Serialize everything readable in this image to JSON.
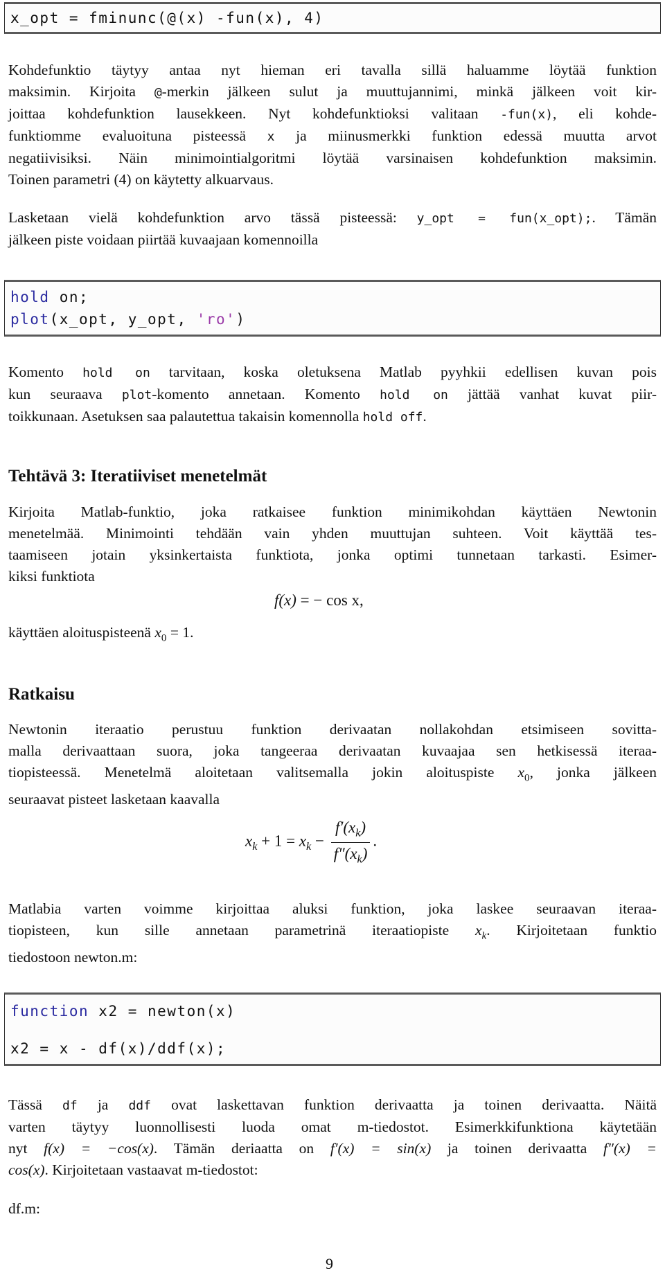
{
  "code_block_1": {
    "lines": [
      "x_opt = fminunc(@(x) -fun(x), 4)"
    ]
  },
  "paragraph_1": {
    "lines": [
      "Kohdefunktio täytyy antaa nyt hieman eri tavalla sillä haluamme löytää funktion",
      "maksimin. Kirjoita @-merkin jälkeen sulut ja muuttujannimi, minkä jälkeen voit kir-",
      "joittaa kohdefunktion lausekkeen. Nyt kohdefunktioksi valitaan -fun(x), eli kohde-",
      "funktiomme evaluoituna pisteessä x ja miinusmerkki funktion edessä muutta arvot",
      "negatiivisiksi. Näin minimointialgoritmi löytää varsinaisen kohdefunktion maksimin.",
      "Toinen parametri (4) on käytetty alkuarvaus."
    ],
    "segments": {
      "l2_a": "maksimin. Kirjoita ",
      "l2_code": "@",
      "l2_b": "-merkin jälkeen sulut ja muuttujannimi, minkä jälkeen voit kir-",
      "l3_a": "joittaa kohdefunktion lausekkeen. Nyt kohdefunktioksi valitaan ",
      "l3_code": "-fun(x)",
      "l3_b": ", eli kohde-",
      "l4_a": "funktiomme evaluoituna pisteessä ",
      "l4_code": "x",
      "l4_b": " ja miinusmerkki funktion edessä muutta arvot"
    }
  },
  "paragraph_2": {
    "l1_a": "Lasketaan vielä kohdefunktion arvo tässä pisteessä: ",
    "l1_code": "y_opt = fun(x_opt);",
    "l1_b": ". Tämän",
    "l2": "jälkeen piste voidaan piirtää kuvaajaan komennoilla"
  },
  "code_block_2": {
    "line1_kw": "hold",
    "line1_rest": " on;",
    "line2_kw": "plot",
    "line2_a": "(x_opt, y_opt, ",
    "line2_str": "'ro'",
    "line2_b": ")"
  },
  "paragraph_3": {
    "l1_a": "Komento ",
    "l1_code": "hold on",
    "l1_b": " tarvitaan, koska oletuksena Matlab pyyhkii edellisen kuvan pois",
    "l2_a": "kun seuraava ",
    "l2_code": "plot",
    "l2_b": "-komento annetaan. Komento ",
    "l2_code2": "hold on",
    "l2_c": " jättää vanhat kuvat piir-",
    "l3_a": "toikkunaan. Asetuksen saa palautettua takaisin komennolla ",
    "l3_code": "hold off",
    "l3_b": "."
  },
  "section_heading": "Tehtävä 3: Iteratiiviset menetelmät",
  "paragraph_4": {
    "lines": [
      "Kirjoita Matlab-funktio, joka ratkaisee funktion minimikohdan käyttäen Newtonin",
      "menetelmää. Minimointi tehdään vain yhden muuttujan suhteen. Voit käyttää tes-",
      "taamiseen jotain yksinkertaista funktiota, jonka optimi tunnetaan tarkasti. Esimer-",
      "kiksi funktiota"
    ]
  },
  "equation_1": {
    "lhs": "f(x)",
    "rhs": "= − cos x,"
  },
  "paragraph_5": {
    "text_a": "käyttäen aloituspisteenä ",
    "var": "x",
    "sub": "0",
    "text_b": " = 1."
  },
  "subheading": "Ratkaisu",
  "paragraph_6": {
    "l1": "Newtonin iteraatio perustuu funktion derivaatan nollakohdan etsimiseen sovitta-",
    "l2": "malla derivaattaan suora, joka tangeeraa derivaatan kuvaajaa sen hetkisessä iteraa-",
    "l3_a": "tiopisteessä. Menetelmä aloitetaan valitsemalla jokin aloituspiste ",
    "l3_var": "x",
    "l3_sub": "0",
    "l3_b": ", jonka jälkeen",
    "l4": "seuraavat pisteet lasketaan kaavalla"
  },
  "equation_2": {
    "lhs_var": "x",
    "lhs_sub": "k",
    "lhs_rest": " + 1 = ",
    "rhs_var": "x",
    "rhs_sub": "k",
    "minus": " − ",
    "num": "f′(x",
    "num_sub": "k",
    "num_close": ")",
    "den": "f″(x",
    "den_sub": "k",
    "den_close": ")",
    "end": "."
  },
  "paragraph_7": {
    "l1": "Matlabia varten voimme kirjoittaa aluksi funktion, joka laskee seuraavan iteraa-",
    "l2_a": "tiopisteen, kun sille annetaan parametrinä iteraatiopiste ",
    "l2_var": "x",
    "l2_sub": "k",
    "l2_b": ". Kirjoitetaan funktio",
    "l3": "tiedostoon newton.m:"
  },
  "code_block_3": {
    "line1_kw": "function",
    "line1_rest": " x2 = newton(x)",
    "line2": "x2 = x - df(x)/ddf(x);"
  },
  "paragraph_8": {
    "l1_a": "Tässä ",
    "l1_code1": "df",
    "l1_b": " ja ",
    "l1_code2": "ddf",
    "l1_c": " ovat laskettavan funktion derivaatta ja toinen derivaatta. Näitä",
    "l2": "varten täytyy luonnollisesti luoda omat m-tiedostot. Esimerkkifunktiona käytetään",
    "l3_a": "nyt ",
    "l3_m1": "f(x) = −cos(x)",
    "l3_b": ". Tämän deriaatta on ",
    "l3_m2": "f′(x) = sin(x)",
    "l3_c": " ja toinen derivaatta ",
    "l3_m3": "f″(x) =",
    "l4_m": "cos(x)",
    "l4_b": ". Kirjoitetaan vastaavat m-tiedostot:"
  },
  "file_label": "df.m:",
  "page_number": "9"
}
